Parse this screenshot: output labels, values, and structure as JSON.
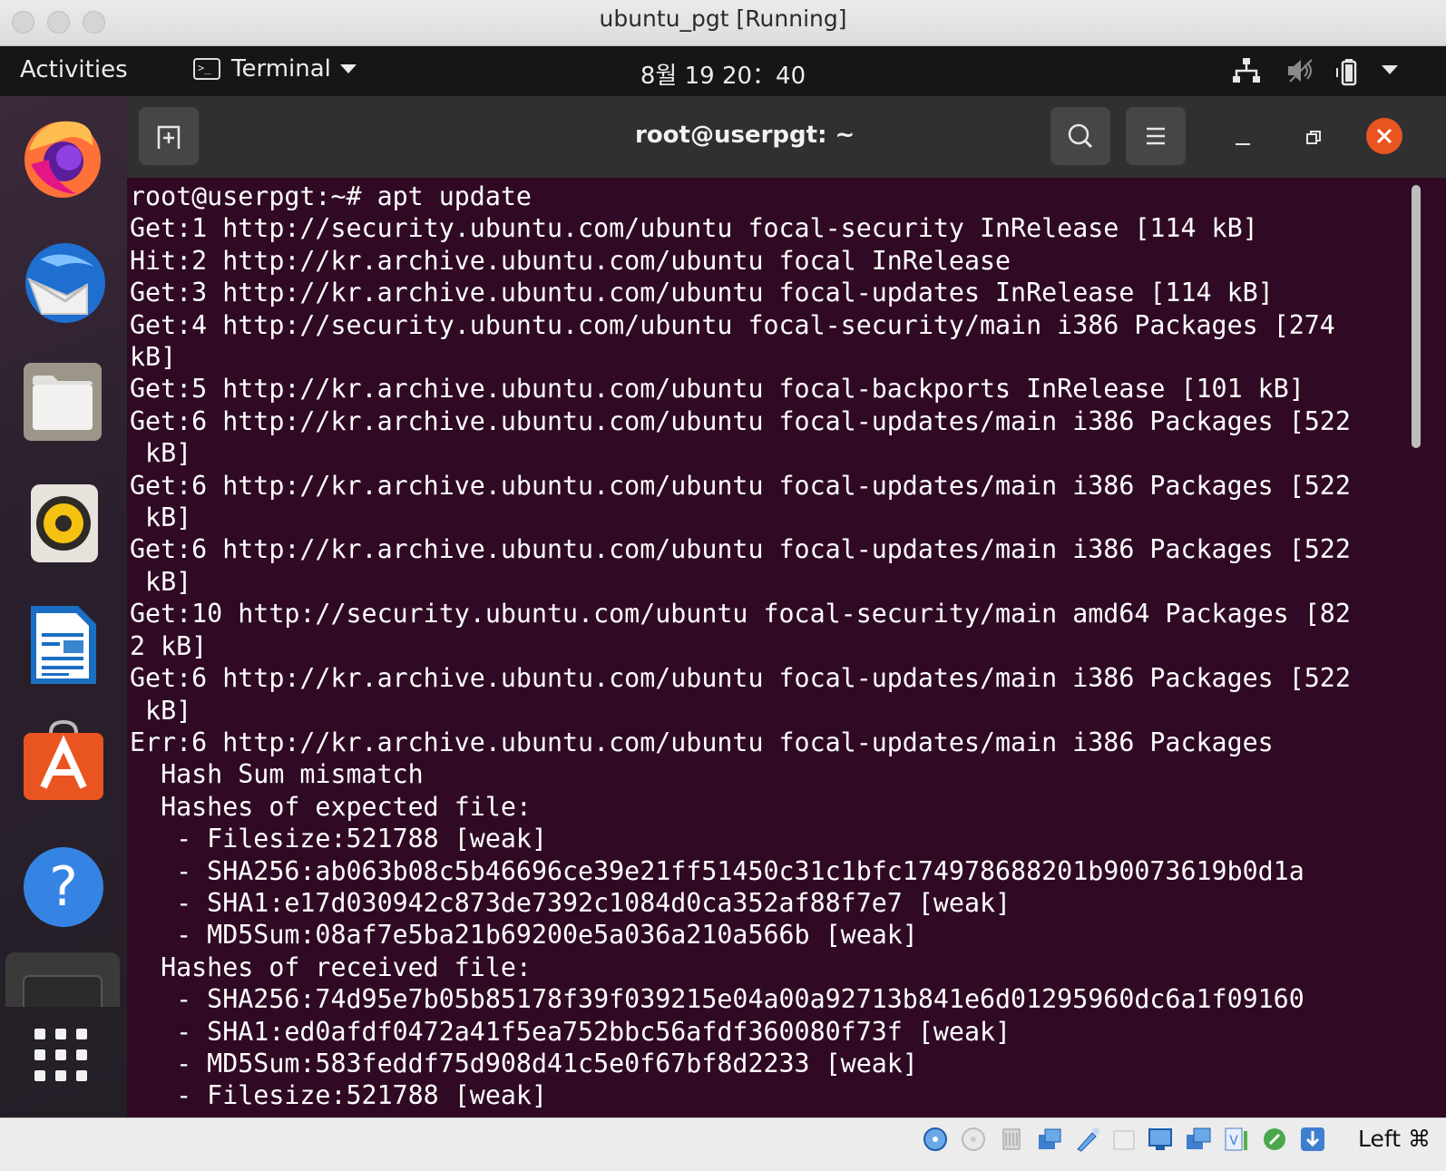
{
  "vm_window": {
    "title": "ubuntu_pgt [Running]"
  },
  "topbar": {
    "activities": "Activities",
    "app_menu": "Terminal",
    "clock": "8월 19  20：40",
    "tray_icons": [
      "network-icon",
      "volume-muted-icon",
      "battery-icon",
      "system-menu-caret-icon"
    ]
  },
  "dock": {
    "apps": [
      "firefox",
      "thunderbird",
      "files",
      "rhythmbox",
      "libreoffice-writer",
      "ubuntu-software",
      "help",
      "terminal"
    ],
    "show_apps": "show-applications"
  },
  "terminal": {
    "title": "root@userpgt: ~",
    "lines": [
      "root@userpgt:~# apt update",
      "Get:1 http://security.ubuntu.com/ubuntu focal-security InRelease [114 kB]",
      "Hit:2 http://kr.archive.ubuntu.com/ubuntu focal InRelease",
      "Get:3 http://kr.archive.ubuntu.com/ubuntu focal-updates InRelease [114 kB]",
      "Get:4 http://security.ubuntu.com/ubuntu focal-security/main i386 Packages [274",
      "kB]",
      "Get:5 http://kr.archive.ubuntu.com/ubuntu focal-backports InRelease [101 kB]",
      "Get:6 http://kr.archive.ubuntu.com/ubuntu focal-updates/main i386 Packages [522",
      " kB]",
      "Get:6 http://kr.archive.ubuntu.com/ubuntu focal-updates/main i386 Packages [522",
      " kB]",
      "Get:6 http://kr.archive.ubuntu.com/ubuntu focal-updates/main i386 Packages [522",
      " kB]",
      "Get:10 http://security.ubuntu.com/ubuntu focal-security/main amd64 Packages [82",
      "2 kB]",
      "Get:6 http://kr.archive.ubuntu.com/ubuntu focal-updates/main i386 Packages [522",
      " kB]",
      "Err:6 http://kr.archive.ubuntu.com/ubuntu focal-updates/main i386 Packages",
      "  Hash Sum mismatch",
      "  Hashes of expected file:",
      "   - Filesize:521788 [weak]",
      "   - SHA256:ab063b08c5b46696ce39e21ff51450c31c1bfc174978688201b90073619b0d1a",
      "   - SHA1:e17d030942c873de7392c1084d0ca352af88f7e7 [weak]",
      "   - MD5Sum:08af7e5ba21b69200e5a036a210a566b [weak]",
      "  Hashes of received file:",
      "   - SHA256:74d95e7b05b85178f39f039215e04a00a92713b841e6d01295960dc6a1f09160",
      "   - SHA1:ed0afdf0472a41f5ea752bbc56afdf360080f73f [weak]",
      "   - MD5Sum:583feddf75d908d41c5e0f67bf8d2233 [weak]",
      "   - Filesize:521788 [weak]"
    ]
  },
  "statusbar": {
    "icons": [
      "optical-drive-icon",
      "floppy-icon",
      "usb-icon",
      "network-adapter-icon",
      "shared-folder-icon",
      "display-icon",
      "video-capture-icon",
      "screen-icon",
      "vt-x-icon",
      "mouse-integration-icon",
      "download-icon"
    ],
    "host_key": "Left ⌘"
  },
  "colors": {
    "terminal_bg": "#300a24",
    "terminal_fg": "#ffffff",
    "ubuntu_orange": "#e95420",
    "topbar_bg": "#161616",
    "header_bg": "#303030"
  }
}
